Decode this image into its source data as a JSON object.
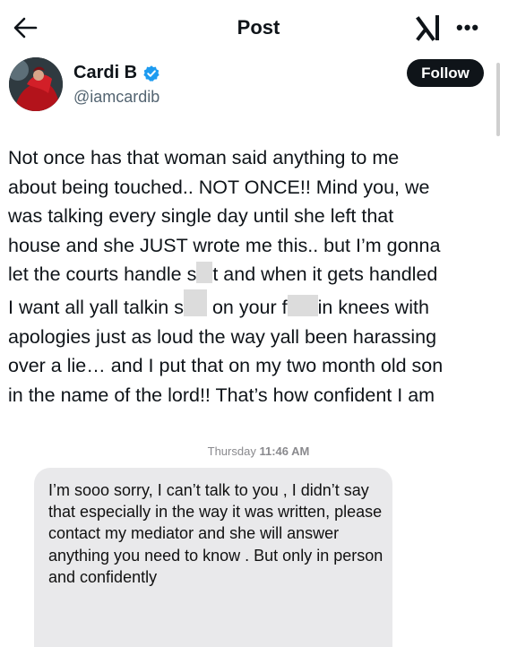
{
  "header": {
    "title": "Post",
    "back_icon": "arrow-left-icon",
    "logo_icon": "xai-logo-icon",
    "more_icon": "more-horizontal-icon"
  },
  "author": {
    "name": "Cardi B",
    "handle": "@iamcardib",
    "verified": true,
    "follow_label": "Follow"
  },
  "tweet": {
    "lines": [
      [
        "Not once has that woman said anything to me"
      ],
      [
        "about being touched.. NOT ONCE!! Mind you, we"
      ],
      [
        "was talking every single day until she left that"
      ],
      [
        "house and she JUST wrote me this.. but I’m gonna"
      ],
      [
        "let the courts handle s",
        "",
        "t and when it gets handled"
      ],
      [
        "I want all yall talkin s",
        "",
        " on your f",
        "",
        "in knees with"
      ],
      [
        "apologies just as loud the way yall been harassing"
      ],
      [
        "over a lie… and I put that on my two month old son"
      ],
      [
        "in the name of the lord!! That’s how confident I am"
      ]
    ]
  },
  "message": {
    "day": "Thursday",
    "time": "11:46 AM",
    "text": "I’m sooo sorry, I can’t talk to you , I didn’t say that especially in the way it was written, please contact my mediator and she will answer anything you need to know . But only in person and confidently"
  },
  "colors": {
    "follow_bg": "#0f1419",
    "verified": "#1d9bf0",
    "bubble": "#e9e9eb",
    "secondary_text": "#536471"
  }
}
